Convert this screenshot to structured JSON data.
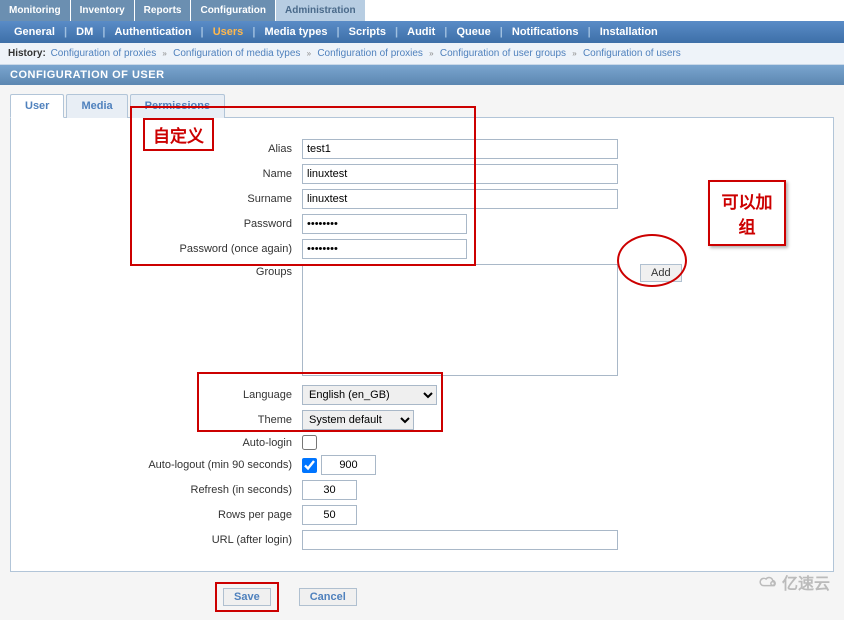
{
  "nav_primary": [
    "Monitoring",
    "Inventory",
    "Reports",
    "Configuration",
    "Administration"
  ],
  "nav_primary_active": 4,
  "nav_secondary": [
    "General",
    "DM",
    "Authentication",
    "Users",
    "Media types",
    "Scripts",
    "Audit",
    "Queue",
    "Notifications",
    "Installation"
  ],
  "nav_secondary_active": 3,
  "history_label": "History:",
  "history_items": [
    "Configuration of proxies",
    "Configuration of media types",
    "Configuration of proxies",
    "Configuration of user groups",
    "Configuration of users"
  ],
  "page_title": "CONFIGURATION OF USER",
  "tabs": [
    "User",
    "Media",
    "Permissions"
  ],
  "tabs_active": 0,
  "labels": {
    "alias": "Alias",
    "name": "Name",
    "surname": "Surname",
    "password": "Password",
    "password2": "Password (once again)",
    "groups": "Groups",
    "language": "Language",
    "theme": "Theme",
    "autologin": "Auto-login",
    "autologout": "Auto-logout (min 90 seconds)",
    "refresh": "Refresh (in seconds)",
    "rows": "Rows per page",
    "url": "URL (after login)"
  },
  "values": {
    "alias": "test1",
    "name": "linuxtest",
    "surname": "linuxtest",
    "password": "••••••••",
    "password2": "••••••••",
    "languages": [
      "English (en_GB)"
    ],
    "themes": [
      "System default"
    ],
    "autologin_checked": false,
    "autologout_checked": true,
    "autologout": "900",
    "refresh": "30",
    "rows": "50",
    "url": ""
  },
  "buttons": {
    "add": "Add",
    "save": "Save",
    "cancel": "Cancel"
  },
  "annotations": {
    "custom": "自定义",
    "can_add_group": "可以加组"
  },
  "footer_logo": "亿速云"
}
